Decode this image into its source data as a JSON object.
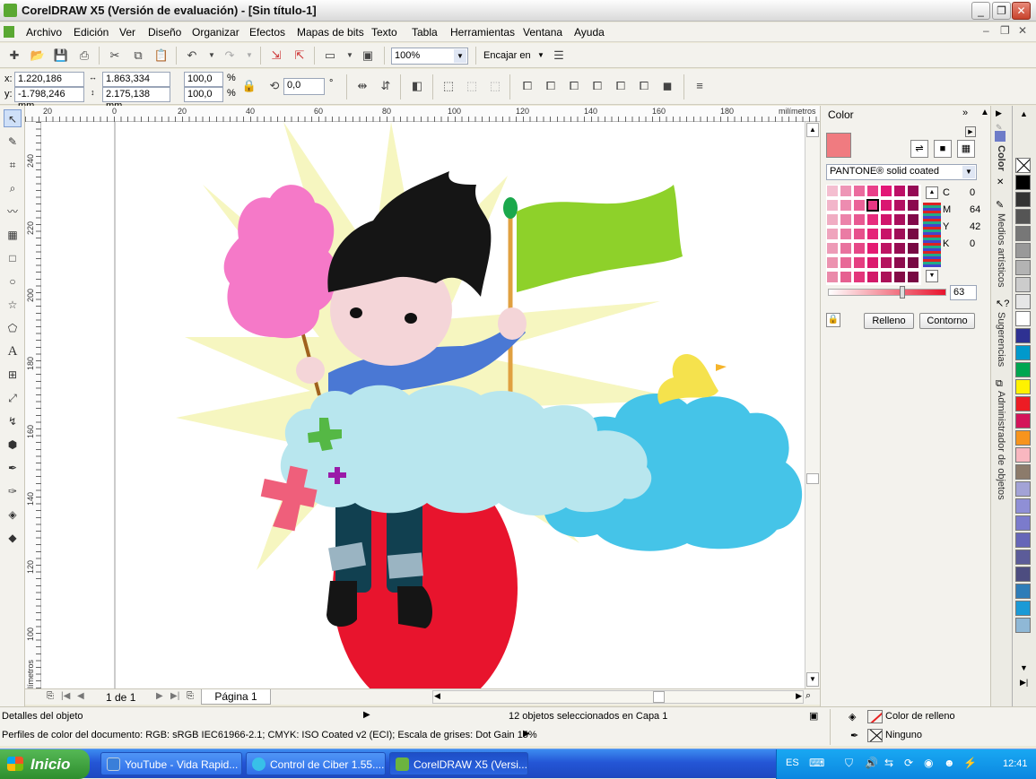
{
  "window": {
    "title": "CorelDRAW X5 (Versión de evaluación) - [Sin título-1]"
  },
  "menu": [
    "Archivo",
    "Edición",
    "Ver",
    "Diseño",
    "Organizar",
    "Efectos",
    "Mapas de bits",
    "Texto",
    "Tabla",
    "Herramientas",
    "Ventana",
    "Ayuda"
  ],
  "toolbar": {
    "zoom": "100%",
    "snap_label": "Encajar en"
  },
  "props": {
    "x": "1.220,186 mm",
    "y": "-1.798,246 mm",
    "w": "1.863,334 mm",
    "h": "2.175,138 mm",
    "sx": "100,0",
    "sy": "100,0",
    "pct": "%",
    "angle": "0,0",
    "deg": "°"
  },
  "rulers": {
    "unit": "milímetros",
    "h_ticks": [
      "20",
      "0",
      "20",
      "40",
      "60",
      "80",
      "100",
      "120",
      "140",
      "160",
      "180"
    ],
    "v_ticks": [
      "240",
      "220",
      "200",
      "180",
      "160",
      "140",
      "120",
      "100"
    ],
    "v_unit": "milímetros"
  },
  "pages": {
    "count": "1 de 1",
    "tab": "Página 1"
  },
  "docker": {
    "title": "Color",
    "palette_select": "PANTONE® solid coated",
    "cmyk": [
      {
        "l": "C",
        "v": "0"
      },
      {
        "l": "M",
        "v": "64"
      },
      {
        "l": "Y",
        "v": "42"
      },
      {
        "l": "K",
        "v": "0"
      }
    ],
    "tint": "63",
    "fill_btn": "Relleno",
    "outline_btn": "Contorno",
    "current_color": "#f07b80"
  },
  "docker_tabs": [
    "Color",
    "Medios artísticos",
    "Sugerencias",
    "Administrador de objetos"
  ],
  "palette": [
    "#000000",
    "#333333",
    "#555555",
    "#777777",
    "#999999",
    "#b3b3b3",
    "#cccccc",
    "#e6e6e6",
    "#ffffff",
    "#2e3192",
    "#0099cc",
    "#00a651",
    "#fff200",
    "#ed1c24",
    "#d4145a",
    "#f7941d",
    "#f9b7c0",
    "#8c7b6b",
    "#a3a3d6",
    "#8f8fd6",
    "#7b7bcc",
    "#6666b8",
    "#5c5c99",
    "#4d4d80",
    "#2e7db8",
    "#1b9ad6",
    "#8fb8d6"
  ],
  "status": {
    "details": "Detalles del objeto",
    "selection": "12 objetos seleccionados en Capa 1",
    "profiles": "Perfiles de color del documento: RGB: sRGB IEC61966-2.1; CMYK: ISO Coated v2 (ECI); Escala de grises: Dot Gain 15%",
    "fill_label": "Color de relleno",
    "outline_label": "Ninguno"
  },
  "taskbar": {
    "start": "Inicio",
    "tasks": [
      "YouTube - Vida Rapid...",
      "Control de Ciber 1.55....",
      "CorelDRAW X5 (Versi..."
    ],
    "lang": "ES",
    "clock": "12:41"
  }
}
